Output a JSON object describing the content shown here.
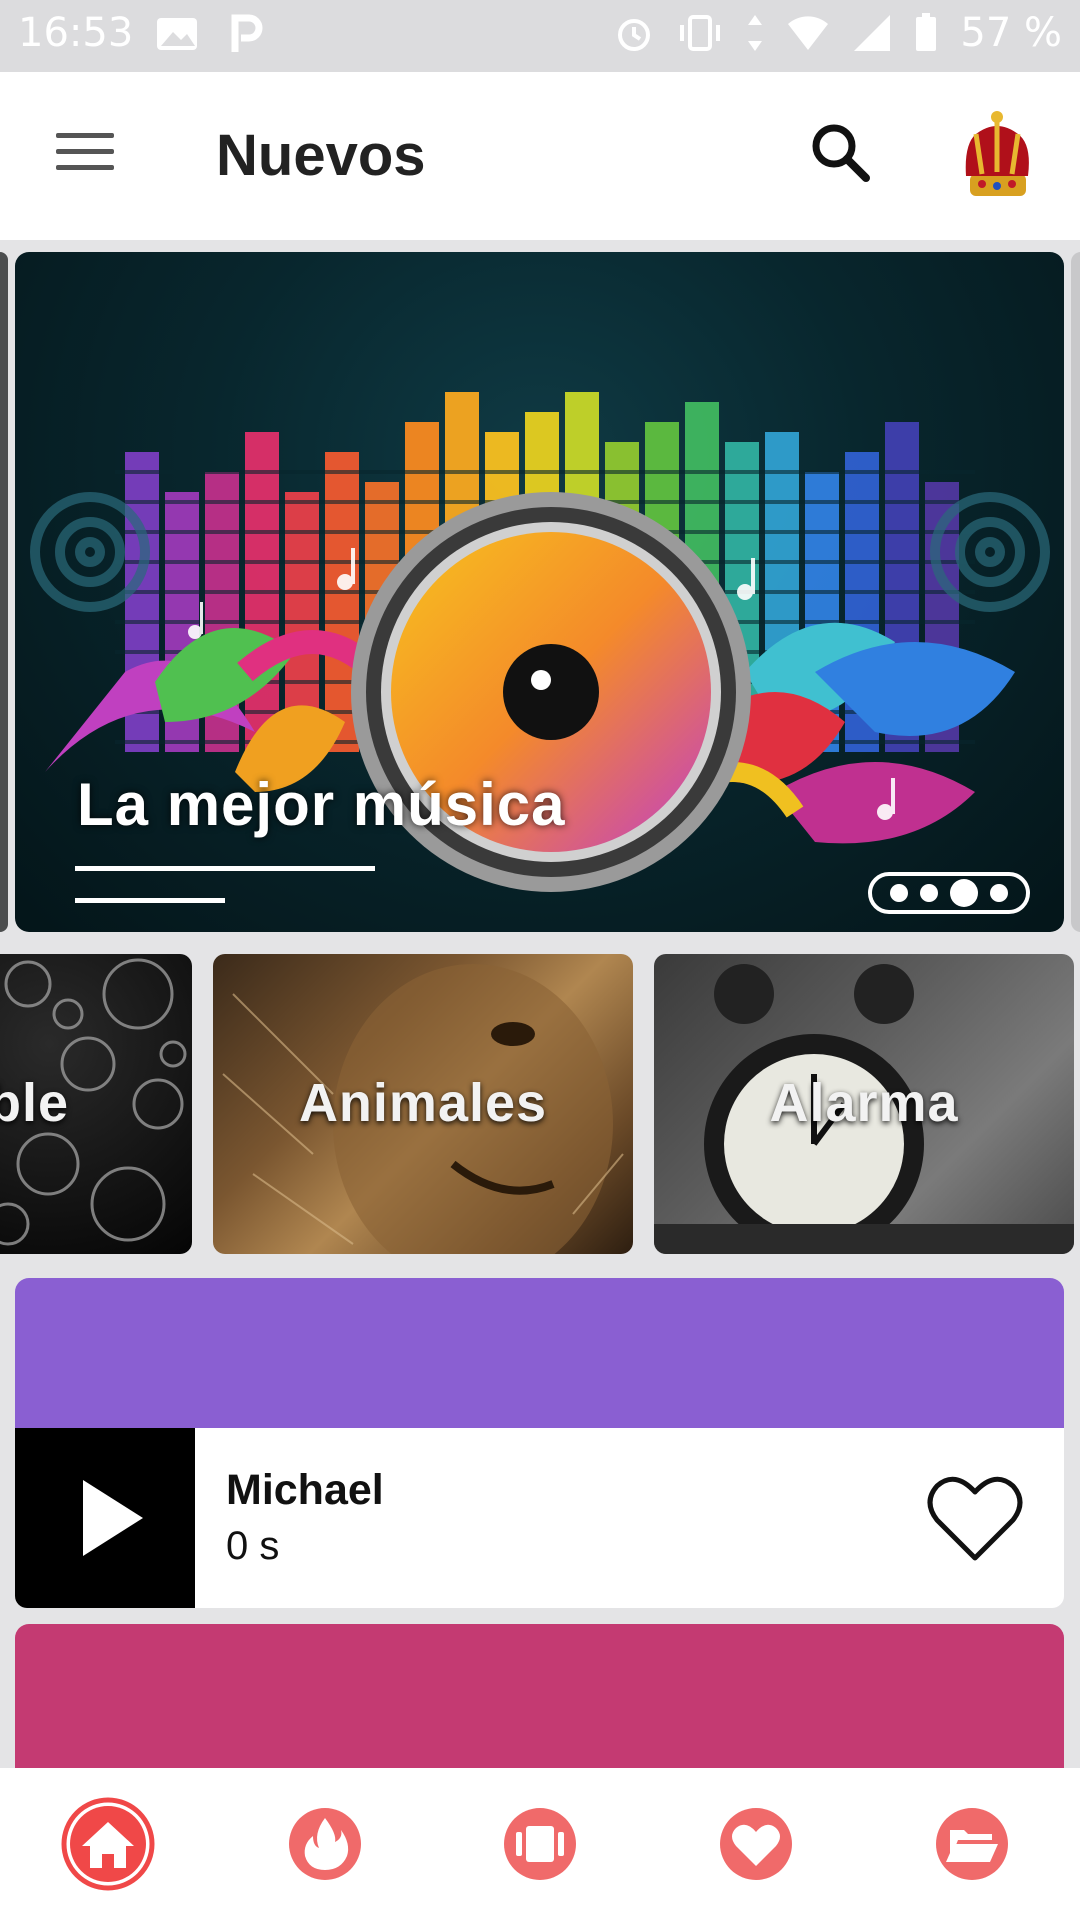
{
  "status_bar": {
    "time": "16:53",
    "battery_percent": "57 %"
  },
  "app_bar": {
    "title": "Nuevos",
    "menu_icon": "menu-icon",
    "search_icon": "search-icon",
    "avatar_icon": "crown-avatar-icon"
  },
  "carousel": {
    "slide_title": "La mejor música",
    "dots": 4,
    "active_dot": 3
  },
  "categories": [
    {
      "label": "ble"
    },
    {
      "label": "Animales"
    },
    {
      "label": "Alarma"
    }
  ],
  "list": {
    "banner_colors": [
      "#8a5fd2",
      "#c43a72"
    ],
    "items": [
      {
        "title": "Michael",
        "duration": "0 s"
      }
    ]
  },
  "bottom_nav": {
    "accent": "#f04848",
    "items": [
      {
        "icon": "home-icon",
        "active": true
      },
      {
        "icon": "fire-icon",
        "active": false
      },
      {
        "icon": "categories-icon",
        "active": false
      },
      {
        "icon": "heart-icon",
        "active": false
      },
      {
        "icon": "folder-icon",
        "active": false
      }
    ]
  }
}
